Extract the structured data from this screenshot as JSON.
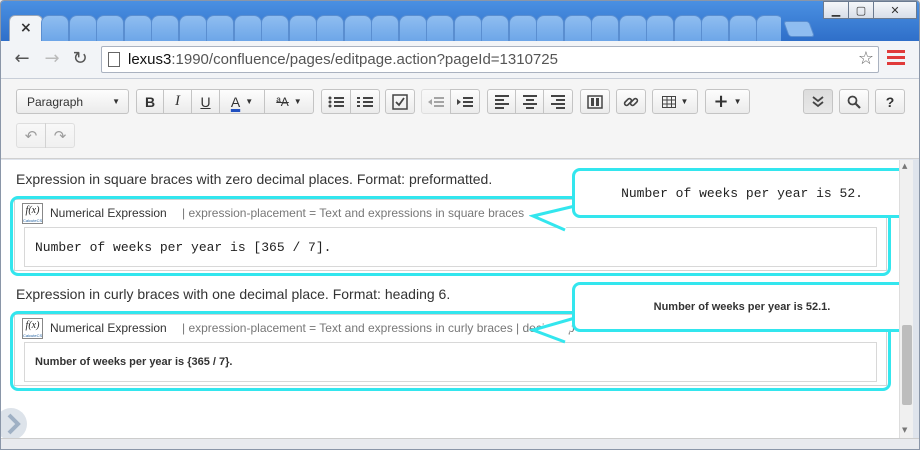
{
  "browser": {
    "tab_close": "×",
    "window_buttons": {
      "minimize": "▁",
      "maximize": "▢",
      "close": "✕"
    },
    "url_host": "lexus3",
    "url_path": ":1990/confluence/pages/editpage.action?pageId=1310725"
  },
  "toolbar": {
    "paragraph_label": "Paragraph",
    "bold": "B",
    "italic": "I",
    "underline": "U",
    "text_color": "A",
    "more_formatting": "ªA"
  },
  "content": {
    "para1": "Expression in square braces with zero decimal places. Format: preformatted.",
    "macro1": {
      "title": "Numerical Expression",
      "params": "| expression-placement = Text and expressions in square braces",
      "body": "Number of weeks per year is [365 / 7]."
    },
    "callout1": "Number of weeks per year is 52.",
    "para2": "Expression in curly braces with one decimal place. Format: heading 6.",
    "macro2": {
      "title": "Numerical Expression",
      "params": "| expression-placement = Text and expressions in curly braces | decimal-p",
      "body": "Number of weeks per year is {365 / 7}."
    },
    "callout2": "Number of weeks per year is 52.1.",
    "macro_icon_label": "f(x)",
    "macro_icon_brand": "CalcuteCS"
  },
  "colors": {
    "highlight": "#33e6ee",
    "menu_red": "#e03a3a"
  }
}
